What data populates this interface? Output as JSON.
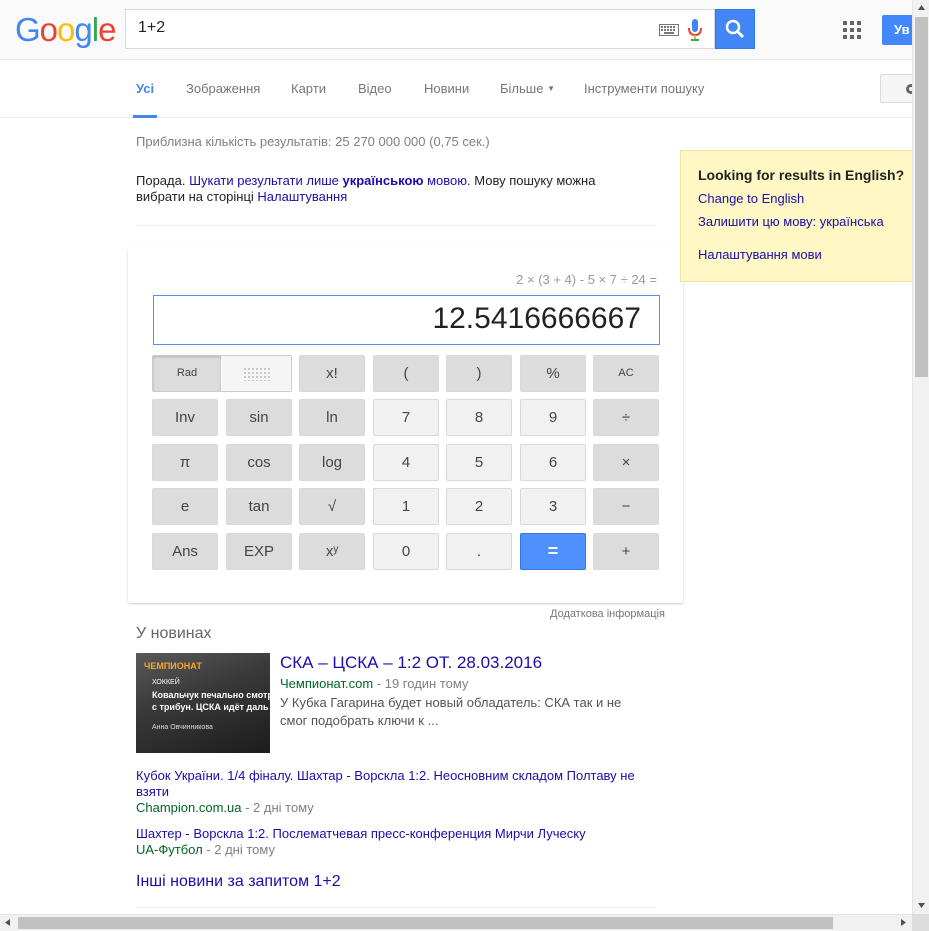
{
  "header": {
    "logo_letters": [
      "G",
      "o",
      "o",
      "g",
      "l",
      "e"
    ],
    "logo_colors": [
      "#4285f4",
      "#ea4335",
      "#fbbc05",
      "#4285f4",
      "#34a853",
      "#ea4335"
    ],
    "query": "1+2",
    "signin_label": "Ув"
  },
  "tabs": [
    {
      "label": "Усі",
      "active": true
    },
    {
      "label": "Зображення"
    },
    {
      "label": "Карти"
    },
    {
      "label": "Відео"
    },
    {
      "label": "Новини"
    },
    {
      "label": "Більше"
    },
    {
      "label": "Інструменти пошуку"
    }
  ],
  "results": {
    "stats": "Приблизна кількість результатів: 25 270 000 000 (0,75 сек.)",
    "tip_prefix": "Порада. ",
    "tip_link1": "Шукати результати лише ",
    "tip_link1_bold": "українською",
    "tip_link1_suffix": " мовою",
    "tip_middle": ". Мову пошуку можна вибрати на сторінці ",
    "tip_link2": "Налаштування"
  },
  "calculator": {
    "expression": "2 × (3 + 4) - 5 × 7 ÷ 24 =",
    "display_value": "12.5416666667",
    "rad_label": "Rad",
    "rows": [
      [
        "x!",
        "(",
        ")",
        "%",
        "AC"
      ],
      [
        "Inv",
        "sin",
        "ln",
        "7",
        "8",
        "9",
        "÷"
      ],
      [
        "π",
        "cos",
        "log",
        "4",
        "5",
        "6",
        "×"
      ],
      [
        "e",
        "tan",
        "√",
        "1",
        "2",
        "3",
        "−"
      ],
      [
        "Ans",
        "EXP",
        "xʸ",
        "0",
        ".",
        "=",
        "+"
      ]
    ],
    "more_info": "Додаткова інформація"
  },
  "news": {
    "heading": "У новинах",
    "thumb": {
      "brand": "ЧЕМПИОНАТ",
      "tag": "ХОККЕЙ",
      "title": "Ковальчук печально смотр\nс трибун. ЦСКА идёт даль",
      "author": "Анна Овчинникова"
    },
    "main": {
      "title": "СКА – ЦСКА – 1:2 ОТ. 28.03.2016",
      "source": "Чемпионат.com",
      "time": " - 19 годин тому",
      "snippet": "У Кубка Гагарина будет новый обладатель: СКА так и не смог подобрать ключи к ..."
    },
    "items": [
      {
        "title": "Кубок України. 1/4 фіналу. Шахтар - Ворскла 1:2. Неосновним складом Полтаву не взяти",
        "source": "Champion.com.ua",
        "time": " - 2 дні тому"
      },
      {
        "title": "Шахтер - Ворскла 1:2. Послематчевая пресс-конференция Мирчи Луческу",
        "source": "UA-Футбол",
        "time": " - 2 дні тому"
      }
    ],
    "more": "Інші новини за запитом 1+2"
  },
  "lang_panel": {
    "title": "Looking for results in English?",
    "change": "Change to English",
    "keep": "Залишити цю мову: українська",
    "settings": "Налаштування мови"
  }
}
